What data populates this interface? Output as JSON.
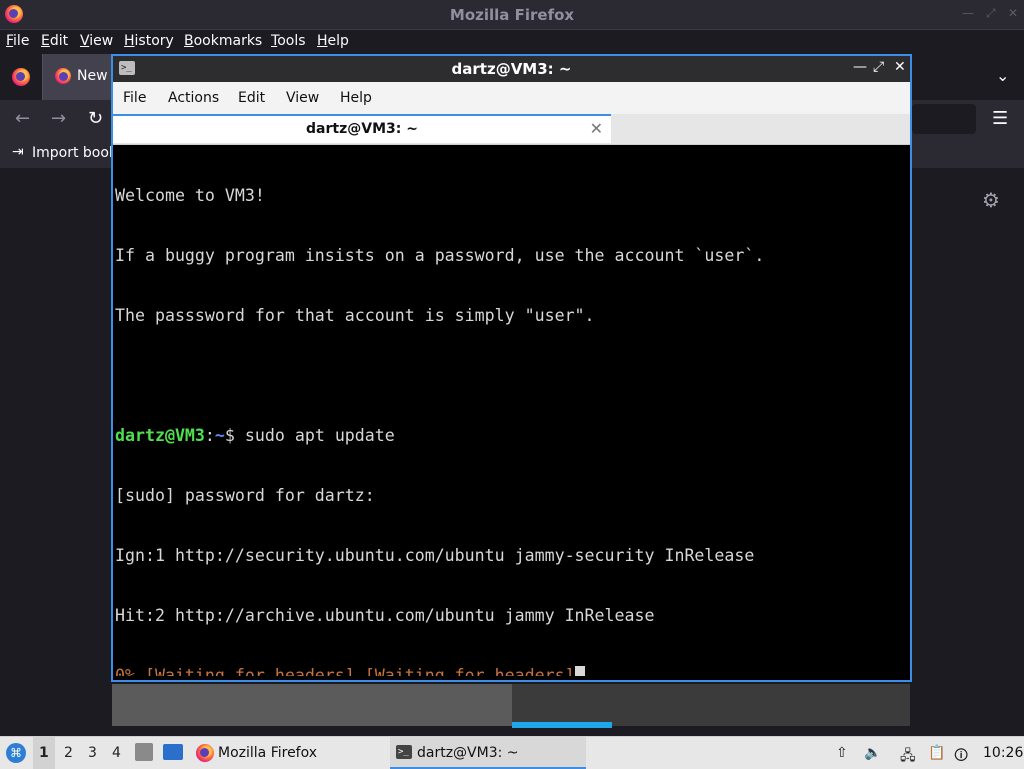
{
  "firefox": {
    "window_title": "Mozilla Firefox",
    "menu": [
      "File",
      "Edit",
      "View",
      "History",
      "Bookmarks",
      "Tools",
      "Help"
    ],
    "tab_label": "New",
    "bookmarks_label": "Import book",
    "icons": {
      "logo": "firefox-icon",
      "back": "back-arrow-icon",
      "forward": "forward-arrow-icon",
      "reload": "reload-icon",
      "menu": "hamburger-icon",
      "settings": "gear-icon",
      "list_tabs": "chevron-down-icon"
    }
  },
  "terminal": {
    "window_title": "dartz@VM3: ~",
    "tab_title": "dartz@VM3: ~",
    "menu": [
      "File",
      "Actions",
      "Edit",
      "View",
      "Help"
    ],
    "lines": [
      {
        "text": "Welcome to VM3!"
      },
      {
        "text": "If a buggy program insists on a password, use the account `user`."
      },
      {
        "text": "The passsword for that account is simply \"user\"."
      },
      {
        "text": ""
      },
      {
        "prompt_user": "dartz@VM3",
        "prompt_sep": ":",
        "prompt_path": "~",
        "prompt_end": "$ ",
        "command": "sudo apt update"
      },
      {
        "text": "[sudo] password for dartz:"
      },
      {
        "text": "Ign:1 http://security.ubuntu.com/ubuntu jammy-security InRelease"
      },
      {
        "text": "Hit:2 http://archive.ubuntu.com/ubuntu jammy InRelease"
      },
      {
        "progress": "0% [Waiting for headers] [Waiting for headers]"
      }
    ],
    "colors": {
      "prompt_user": "#4fe04f",
      "prompt_path": "#5b8cf5",
      "progress": "#c8733a",
      "border": "#3d8ee6"
    }
  },
  "taskbar": {
    "workspaces": [
      "1",
      "2",
      "3",
      "4"
    ],
    "active_workspace": "1",
    "tasks": [
      {
        "label": "Mozilla Firefox",
        "icon": "firefox-icon"
      },
      {
        "label": "dartz@VM3: ~",
        "icon": "terminal-icon"
      }
    ],
    "clock": "10:26",
    "tray_icons": [
      "upload-icon",
      "volume-icon",
      "network-icon",
      "clipboard-icon",
      "notification-icon"
    ]
  }
}
